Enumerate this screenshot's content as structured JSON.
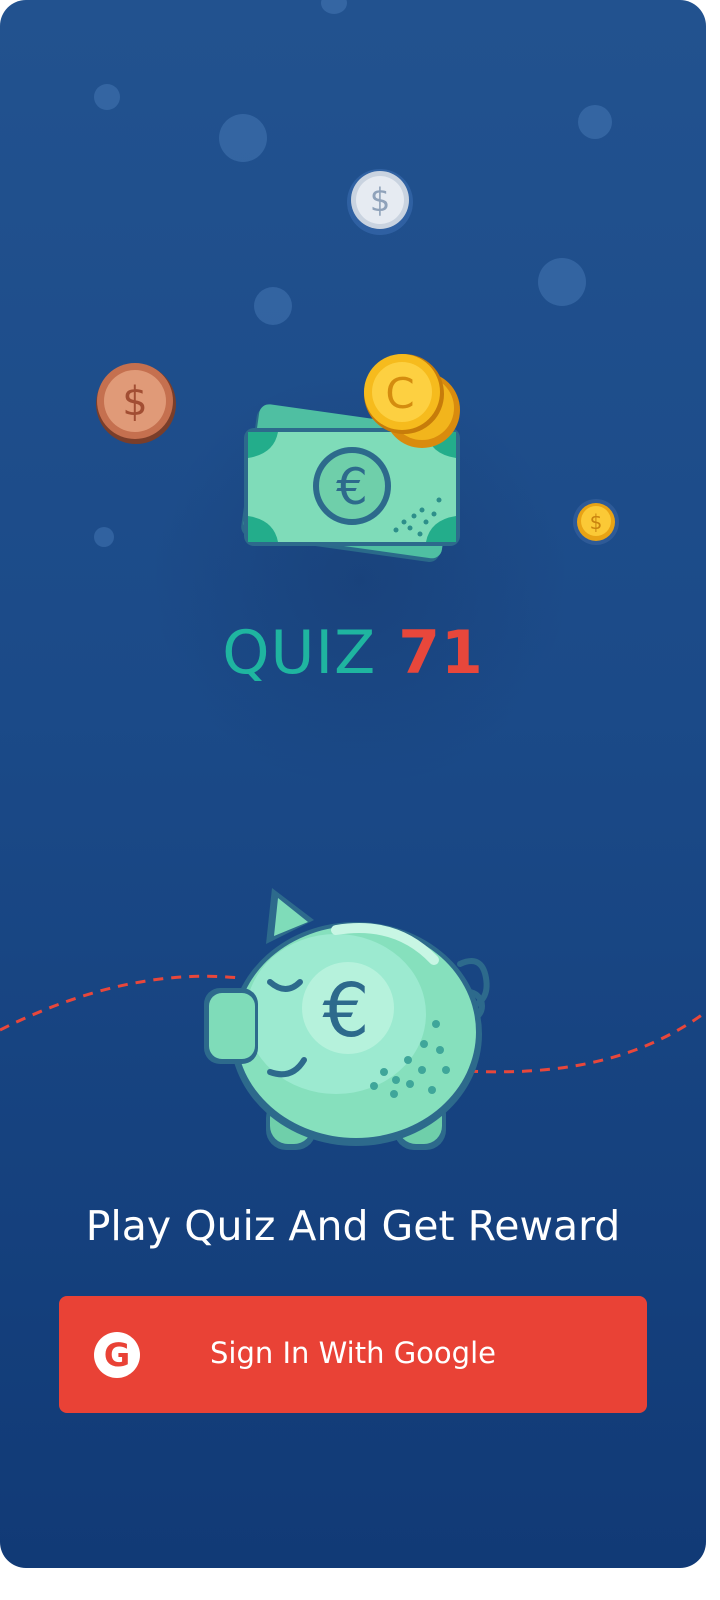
{
  "app": {
    "title_word": "QUIZ",
    "title_number": "71",
    "tagline": "Play Quiz And Get Reward"
  },
  "signin": {
    "label": "Sign In With Google",
    "icon": "google-g-icon",
    "icon_glyph": "G"
  },
  "colors": {
    "background_top": "#22528f",
    "background_bottom": "#113a76",
    "title_word": "#1fb5a0",
    "title_number": "#e8473b",
    "button": "#e94236"
  },
  "illustrations": {
    "coins": [
      "silver-dollar-coin-icon",
      "bronze-dollar-coin-icon",
      "gold-dollar-coin-icon",
      "gold-cent-coin-icon"
    ],
    "money": "euro-banknote-icon",
    "piggy": "euro-piggy-bank-icon"
  }
}
